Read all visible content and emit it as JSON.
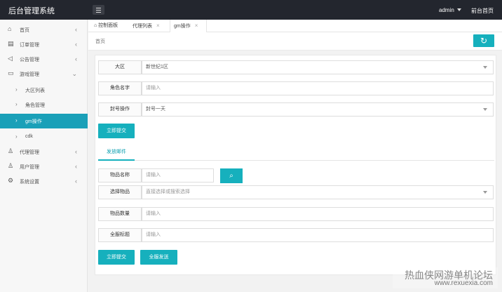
{
  "header": {
    "brand": "后台管理系统",
    "user": "admin",
    "home_link": "前台首页"
  },
  "sidebar": {
    "items": [
      {
        "label": "首页",
        "icon": "home-icon"
      },
      {
        "label": "订单管理",
        "icon": "file-icon"
      },
      {
        "label": "公告管理",
        "icon": "speaker-icon"
      },
      {
        "label": "游戏管理",
        "icon": "server-icon"
      },
      {
        "label": "大区列表",
        "icon": "chevron-right-icon"
      },
      {
        "label": "角色管理",
        "icon": "chevron-right-icon"
      },
      {
        "label": "gm操作",
        "icon": "chevron-right-icon",
        "active": true
      },
      {
        "label": "cdk",
        "icon": "chevron-right-icon"
      },
      {
        "label": "代理管理",
        "icon": "user-icon"
      },
      {
        "label": "用户管理",
        "icon": "user-icon"
      },
      {
        "label": "系统设置",
        "icon": "gear-icon"
      }
    ]
  },
  "tabs": [
    {
      "label": "控制面板",
      "icon": "home-icon"
    },
    {
      "label": "代理列表",
      "closable": true
    },
    {
      "label": "gm操作",
      "closable": true,
      "active": true
    }
  ],
  "breadcrumb": {
    "label": "首页"
  },
  "form1": {
    "region_label": "大区",
    "region_value": "新世纪1区",
    "role_label": "角色名字",
    "role_placeholder": "请输入",
    "ban_label": "封号操作",
    "ban_value": "封号一天",
    "submit": "立即提交"
  },
  "section_tab": "发放邮件",
  "form2": {
    "item_name_label": "物品名称",
    "item_name_placeholder": "请输入",
    "choose_item_label": "选择物品",
    "choose_item_placeholder": "直接选择或搜索选择",
    "quantity_label": "物品数量",
    "quantity_placeholder": "请输入",
    "mail_title_label": "全服标题",
    "mail_title_placeholder": "请输入",
    "submit": "立即提交",
    "send_all": "全服发送"
  },
  "watermark": {
    "line1": "热血侠网游单机论坛",
    "line2": "www.rexuexia.com"
  }
}
